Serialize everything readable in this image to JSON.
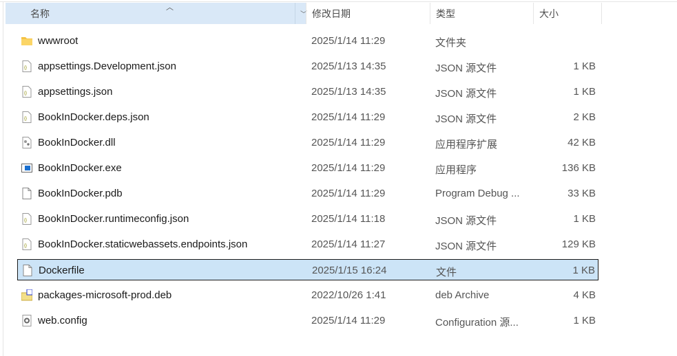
{
  "columns": {
    "name": "名称",
    "date": "修改日期",
    "type": "类型",
    "size": "大小"
  },
  "files": [
    {
      "name": "wwwroot",
      "date": "2025/1/14 11:29",
      "type": "文件夹",
      "size": "",
      "icon": "folder-icon"
    },
    {
      "name": "appsettings.Development.json",
      "date": "2025/1/13 14:35",
      "type": "JSON 源文件",
      "size": "1 KB",
      "icon": "json-file-icon"
    },
    {
      "name": "appsettings.json",
      "date": "2025/1/13 14:35",
      "type": "JSON 源文件",
      "size": "1 KB",
      "icon": "json-file-icon"
    },
    {
      "name": "BookInDocker.deps.json",
      "date": "2025/1/14 11:29",
      "type": "JSON 源文件",
      "size": "2 KB",
      "icon": "json-file-icon"
    },
    {
      "name": "BookInDocker.dll",
      "date": "2025/1/14 11:29",
      "type": "应用程序扩展",
      "size": "42 KB",
      "icon": "dll-file-icon"
    },
    {
      "name": "BookInDocker.exe",
      "date": "2025/1/14 11:29",
      "type": "应用程序",
      "size": "136 KB",
      "icon": "exe-file-icon"
    },
    {
      "name": "BookInDocker.pdb",
      "date": "2025/1/14 11:29",
      "type": "Program Debug ...",
      "size": "33 KB",
      "icon": "file-icon"
    },
    {
      "name": "BookInDocker.runtimeconfig.json",
      "date": "2025/1/14 11:18",
      "type": "JSON 源文件",
      "size": "1 KB",
      "icon": "json-file-icon"
    },
    {
      "name": "BookInDocker.staticwebassets.endpoints.json",
      "date": "2025/1/14 11:27",
      "type": "JSON 源文件",
      "size": "129 KB",
      "icon": "json-file-icon"
    },
    {
      "name": "Dockerfile",
      "date": "2025/1/15 16:24",
      "type": "文件",
      "size": "1 KB",
      "icon": "file-icon",
      "selected": true
    },
    {
      "name": "packages-microsoft-prod.deb",
      "date": "2022/10/26 1:41",
      "type": "deb Archive",
      "size": "4 KB",
      "icon": "archive-icon"
    },
    {
      "name": "web.config",
      "date": "2025/1/14 11:29",
      "type": "Configuration 源...",
      "size": "1 KB",
      "icon": "config-file-icon"
    }
  ]
}
